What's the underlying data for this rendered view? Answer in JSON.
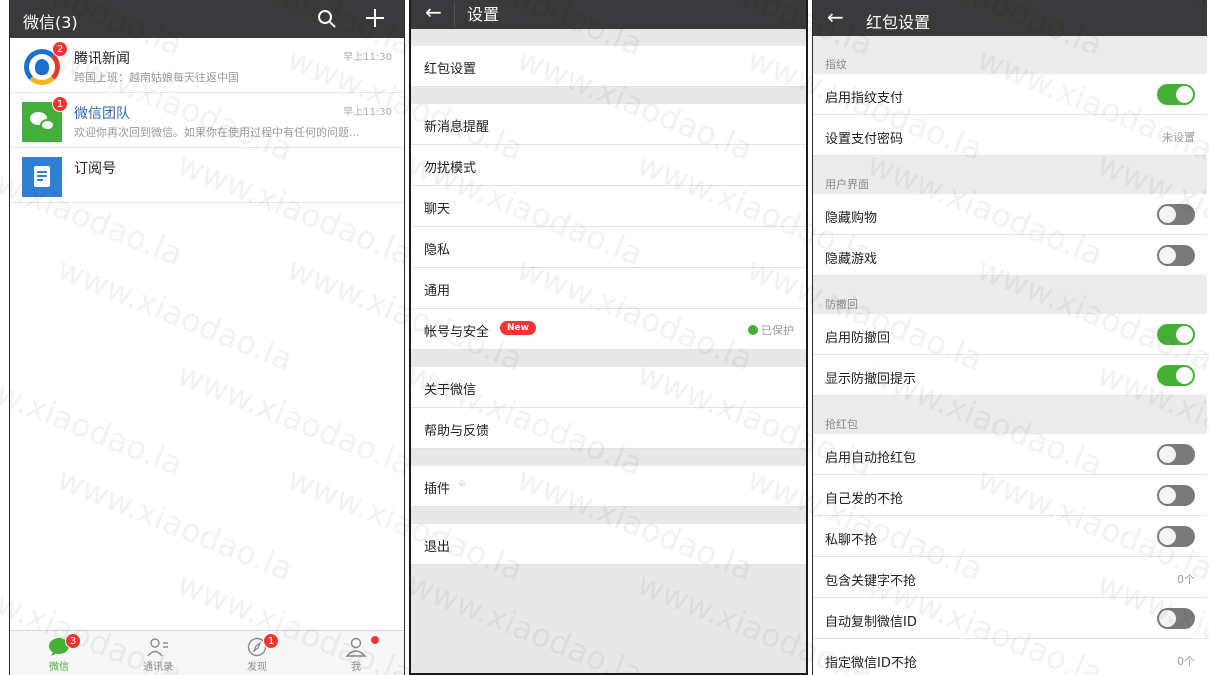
{
  "chat_list": {
    "title": "微信(3)",
    "chats": [
      {
        "name": "腾讯新闻",
        "preview": "跨国上班：越南姑娘每天往返中国",
        "time": "早上11:30",
        "badge": "2"
      },
      {
        "name": "微信团队",
        "preview": "欢迎你再次回到微信。如果你在使用过程中有任何的问题...",
        "time": "早上11:30",
        "badge": "1"
      },
      {
        "name": "订阅号",
        "preview": "",
        "time": "",
        "badge": ""
      }
    ],
    "tabs": [
      {
        "label": "微信",
        "badge": "3",
        "icon": "chat-bubble-icon"
      },
      {
        "label": "通讯录",
        "badge": "",
        "icon": "contacts-icon"
      },
      {
        "label": "发现",
        "badge": "1",
        "icon": "compass-icon"
      },
      {
        "label": "我",
        "badge": "dot",
        "icon": "person-icon"
      }
    ]
  },
  "settings": {
    "title": "设置",
    "items": [
      {
        "label": "红包设置"
      },
      {
        "label": "新消息提醒"
      },
      {
        "label": "勿扰模式"
      },
      {
        "label": "聊天"
      },
      {
        "label": "隐私"
      },
      {
        "label": "通用"
      },
      {
        "label": "帐号与安全",
        "badge": "New",
        "value": "已保护"
      },
      {
        "label": "关于微信"
      },
      {
        "label": "帮助与反馈"
      },
      {
        "label": "插件"
      },
      {
        "label": "退出"
      }
    ]
  },
  "red_packet": {
    "title": "红包设置",
    "sections": [
      {
        "header": "指纹",
        "rows": [
          {
            "label": "启用指纹支付",
            "toggle": "on"
          },
          {
            "label": "设置支付密码",
            "value": "未设置"
          }
        ]
      },
      {
        "header": "用户界面",
        "rows": [
          {
            "label": "隐藏购物",
            "toggle": "off"
          },
          {
            "label": "隐藏游戏",
            "toggle": "off"
          }
        ]
      },
      {
        "header": "防撤回",
        "rows": [
          {
            "label": "启用防撤回",
            "toggle": "on"
          },
          {
            "label": "显示防撤回提示",
            "toggle": "on"
          }
        ]
      },
      {
        "header": "抢红包",
        "rows": [
          {
            "label": "启用自动抢红包",
            "toggle": "off"
          },
          {
            "label": "自己发的不抢",
            "toggle": "off"
          },
          {
            "label": "私聊不抢",
            "toggle": "off"
          },
          {
            "label": "包含关键字不抢",
            "value": "0个"
          },
          {
            "label": "自动复制微信ID",
            "toggle": "off"
          },
          {
            "label": "指定微信ID不抢",
            "value": "0个"
          }
        ]
      }
    ]
  },
  "watermark": "www.xiaodao.la",
  "colors": {
    "accent": "#45b035",
    "badge": "#f43530",
    "topbar": "#3a3a3c"
  }
}
